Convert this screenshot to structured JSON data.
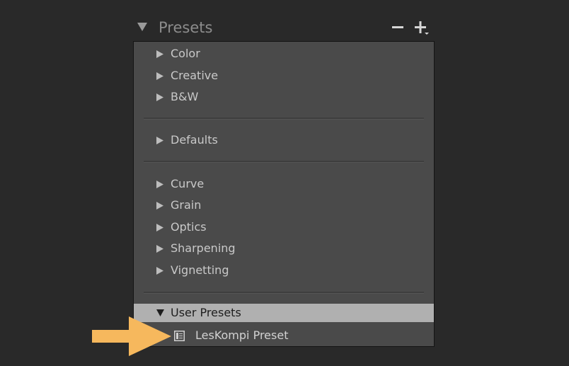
{
  "panel": {
    "title": "Presets",
    "groups": [
      {
        "label": "Color"
      },
      {
        "label": "Creative"
      },
      {
        "label": "B&W"
      },
      {
        "label": "Defaults"
      },
      {
        "label": "Curve"
      },
      {
        "label": "Grain"
      },
      {
        "label": "Optics"
      },
      {
        "label": "Sharpening"
      },
      {
        "label": "Vignetting"
      }
    ],
    "user_presets": {
      "label": "User Presets",
      "items": [
        {
          "label": "LesKompi Preset"
        }
      ]
    }
  },
  "colors": {
    "background": "#292929",
    "panel": "#4a4a4a",
    "selected_row": "#b0b0b0",
    "callout_arrow": "#f6b85d"
  },
  "icons": {
    "collapse": "triangle-down-icon",
    "expand": "triangle-right-icon",
    "remove": "minus-icon",
    "add": "plus-dropdown-icon",
    "preset": "preset-document-icon",
    "callout": "arrow-right-icon"
  }
}
